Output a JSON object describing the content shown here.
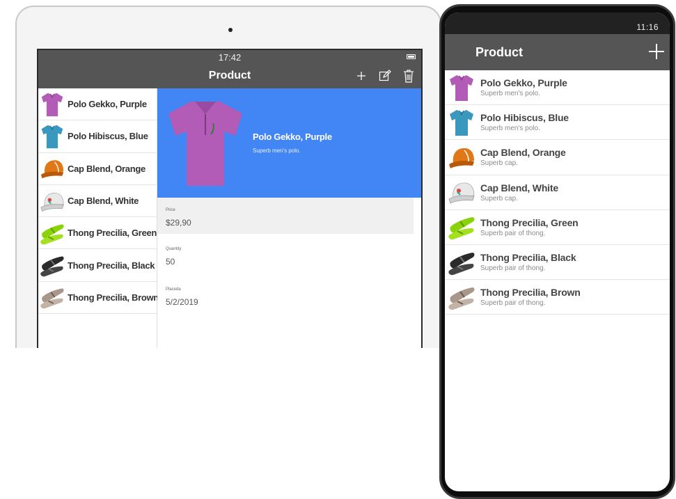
{
  "colors": {
    "header": "#555555",
    "accent": "#4285f4",
    "polo_purple": "#b25cb8",
    "polo_blue": "#3a98bf",
    "cap_orange": "#e07818",
    "cap_white": "#e8e8e8",
    "thong_green": "#8ad20a",
    "thong_black": "#2a2a2a",
    "thong_brown": "#a8978a"
  },
  "tablet": {
    "status_time": "17:42",
    "title": "Product",
    "actions": [
      "add-icon",
      "edit-icon",
      "trash-icon"
    ],
    "list": [
      {
        "label": "Polo Gekko, Purple",
        "icon": "polo-purple"
      },
      {
        "label": "Polo Hibiscus, Blue",
        "icon": "polo-blue"
      },
      {
        "label": "Cap Blend, Orange",
        "icon": "cap-orange"
      },
      {
        "label": "Cap Blend, White",
        "icon": "cap-white"
      },
      {
        "label": "Thong Precilia, Green",
        "icon": "thong-green"
      },
      {
        "label": "Thong Precilia, Black",
        "icon": "thong-black"
      },
      {
        "label": "Thong Precilia, Brown",
        "icon": "thong-brown"
      }
    ],
    "detail": {
      "name": "Polo Gekko, Purple",
      "description": "Superb men's polo.",
      "fields": [
        {
          "label": "Price",
          "value": "$29,90"
        },
        {
          "label": "Quantity",
          "value": "50"
        },
        {
          "label": "Placeda",
          "value": "5/2/2019"
        }
      ]
    }
  },
  "phone": {
    "status_time": "11:16",
    "title": "Product",
    "add_icon": "plus-icon",
    "list": [
      {
        "name": "Polo Gekko, Purple",
        "sub": "Superb men's polo.",
        "icon": "polo-purple"
      },
      {
        "name": "Polo Hibiscus, Blue",
        "sub": "Superb men's polo.",
        "icon": "polo-blue"
      },
      {
        "name": "Cap Blend, Orange",
        "sub": "Superb cap.",
        "icon": "cap-orange"
      },
      {
        "name": "Cap Blend, White",
        "sub": "Superb cap.",
        "icon": "cap-white"
      },
      {
        "name": "Thong Precilia, Green",
        "sub": "Superb pair of thong.",
        "icon": "thong-green"
      },
      {
        "name": "Thong Precilia, Black",
        "sub": "Superb pair of thong.",
        "icon": "thong-black"
      },
      {
        "name": "Thong Precilia, Brown",
        "sub": "Superb pair of thong.",
        "icon": "thong-brown"
      }
    ]
  }
}
